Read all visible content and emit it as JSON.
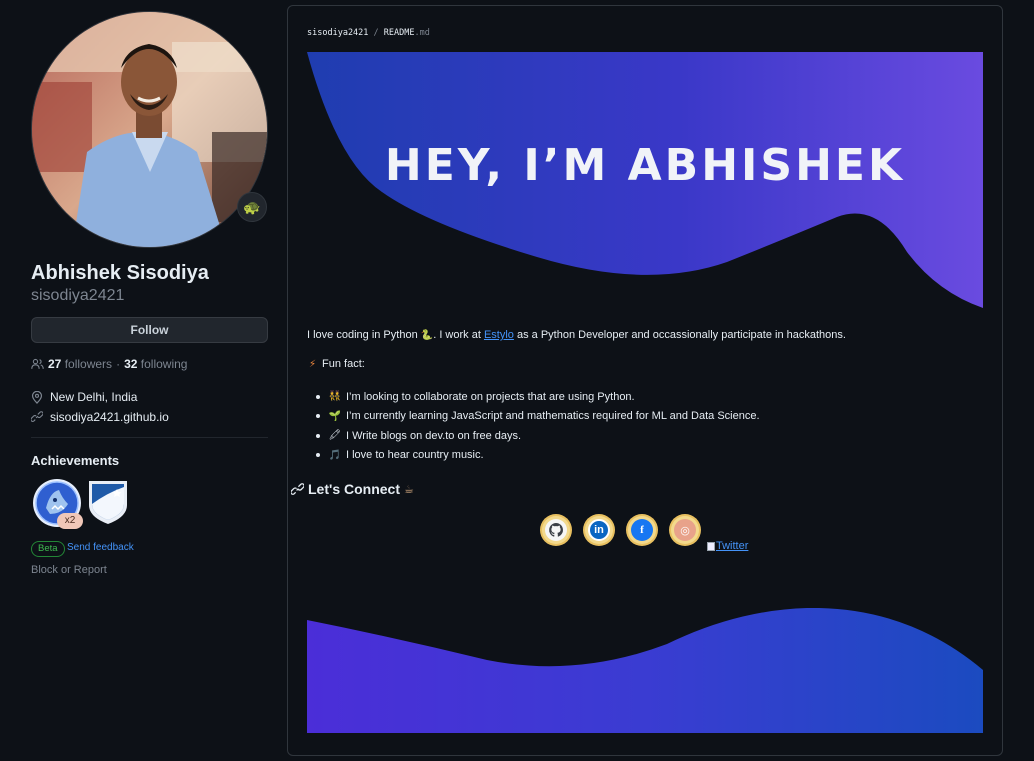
{
  "profile": {
    "full_name": "Abhishek Sisodiya",
    "username": "sisodiya2421",
    "follow_label": "Follow",
    "followers_count": "27",
    "followers_label": "followers",
    "separator": "·",
    "following_count": "32",
    "following_label": "following",
    "location": "New Delhi, India",
    "website": "sisodiya2421.github.io",
    "status_emoji": "🐢"
  },
  "achievements": {
    "title": "Achievements",
    "badges": [
      {
        "name": "pull-shark",
        "multiplier": "x2"
      },
      {
        "name": "starstruck"
      }
    ],
    "beta_label": "Beta",
    "feedback_label": "Send feedback",
    "block_label": "Block or Report"
  },
  "readme": {
    "breadcrumb_user": "sisodiya2421",
    "breadcrumb_sep": "/",
    "breadcrumb_file": "README",
    "breadcrumb_ext": ".md",
    "banner_heading": "HEY, I’M ABHISHEK",
    "intro_before": "I love coding in Python ",
    "intro_python_emoji": "🐍",
    "intro_mid": ". I work at ",
    "intro_company": "Estylo",
    "intro_after": " as a Python Developer and occassionally participate in hackathons.",
    "funfact_icon": "⚡",
    "funfact_label": "Fun fact:",
    "facts": [
      {
        "emoji": "👯",
        "text": "I’m looking to collaborate on projects that are using Python."
      },
      {
        "emoji": "🌱",
        "text": "I’m currently learning JavaScript and mathematics required for ML and Data Science."
      },
      {
        "emoji": "🖍",
        "text": "I Write blogs on dev.to on free days."
      },
      {
        "emoji": "🎵",
        "text": "I love to hear country music."
      }
    ],
    "connect_title": "Let's Connect",
    "connect_emoji": "☕",
    "social": [
      {
        "name": "github",
        "glyph": "",
        "color": "#3b3f46"
      },
      {
        "name": "linkedin",
        "glyph": "in",
        "color": "#0a66c2"
      },
      {
        "name": "facebook",
        "glyph": "f",
        "color": "#1877f2"
      },
      {
        "name": "instagram",
        "glyph": "◎",
        "color": "#d6475a"
      }
    ],
    "twitter_alt": "Twitter"
  },
  "colors": {
    "background": "#0d1117",
    "link": "#4493f8",
    "banner_start": "#1e3fb0",
    "banner_end": "#6a4be0"
  }
}
